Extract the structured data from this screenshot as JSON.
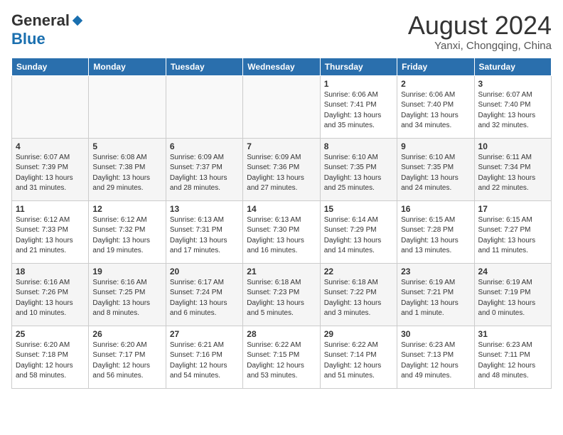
{
  "logo": {
    "general": "General",
    "blue": "Blue"
  },
  "header": {
    "month": "August 2024",
    "location": "Yanxi, Chongqing, China"
  },
  "days_of_week": [
    "Sunday",
    "Monday",
    "Tuesday",
    "Wednesday",
    "Thursday",
    "Friday",
    "Saturday"
  ],
  "weeks": [
    [
      {
        "day": "",
        "info": ""
      },
      {
        "day": "",
        "info": ""
      },
      {
        "day": "",
        "info": ""
      },
      {
        "day": "",
        "info": ""
      },
      {
        "day": "1",
        "info": "Sunrise: 6:06 AM\nSunset: 7:41 PM\nDaylight: 13 hours\nand 35 minutes."
      },
      {
        "day": "2",
        "info": "Sunrise: 6:06 AM\nSunset: 7:40 PM\nDaylight: 13 hours\nand 34 minutes."
      },
      {
        "day": "3",
        "info": "Sunrise: 6:07 AM\nSunset: 7:40 PM\nDaylight: 13 hours\nand 32 minutes."
      }
    ],
    [
      {
        "day": "4",
        "info": "Sunrise: 6:07 AM\nSunset: 7:39 PM\nDaylight: 13 hours\nand 31 minutes."
      },
      {
        "day": "5",
        "info": "Sunrise: 6:08 AM\nSunset: 7:38 PM\nDaylight: 13 hours\nand 29 minutes."
      },
      {
        "day": "6",
        "info": "Sunrise: 6:09 AM\nSunset: 7:37 PM\nDaylight: 13 hours\nand 28 minutes."
      },
      {
        "day": "7",
        "info": "Sunrise: 6:09 AM\nSunset: 7:36 PM\nDaylight: 13 hours\nand 27 minutes."
      },
      {
        "day": "8",
        "info": "Sunrise: 6:10 AM\nSunset: 7:35 PM\nDaylight: 13 hours\nand 25 minutes."
      },
      {
        "day": "9",
        "info": "Sunrise: 6:10 AM\nSunset: 7:35 PM\nDaylight: 13 hours\nand 24 minutes."
      },
      {
        "day": "10",
        "info": "Sunrise: 6:11 AM\nSunset: 7:34 PM\nDaylight: 13 hours\nand 22 minutes."
      }
    ],
    [
      {
        "day": "11",
        "info": "Sunrise: 6:12 AM\nSunset: 7:33 PM\nDaylight: 13 hours\nand 21 minutes."
      },
      {
        "day": "12",
        "info": "Sunrise: 6:12 AM\nSunset: 7:32 PM\nDaylight: 13 hours\nand 19 minutes."
      },
      {
        "day": "13",
        "info": "Sunrise: 6:13 AM\nSunset: 7:31 PM\nDaylight: 13 hours\nand 17 minutes."
      },
      {
        "day": "14",
        "info": "Sunrise: 6:13 AM\nSunset: 7:30 PM\nDaylight: 13 hours\nand 16 minutes."
      },
      {
        "day": "15",
        "info": "Sunrise: 6:14 AM\nSunset: 7:29 PM\nDaylight: 13 hours\nand 14 minutes."
      },
      {
        "day": "16",
        "info": "Sunrise: 6:15 AM\nSunset: 7:28 PM\nDaylight: 13 hours\nand 13 minutes."
      },
      {
        "day": "17",
        "info": "Sunrise: 6:15 AM\nSunset: 7:27 PM\nDaylight: 13 hours\nand 11 minutes."
      }
    ],
    [
      {
        "day": "18",
        "info": "Sunrise: 6:16 AM\nSunset: 7:26 PM\nDaylight: 13 hours\nand 10 minutes."
      },
      {
        "day": "19",
        "info": "Sunrise: 6:16 AM\nSunset: 7:25 PM\nDaylight: 13 hours\nand 8 minutes."
      },
      {
        "day": "20",
        "info": "Sunrise: 6:17 AM\nSunset: 7:24 PM\nDaylight: 13 hours\nand 6 minutes."
      },
      {
        "day": "21",
        "info": "Sunrise: 6:18 AM\nSunset: 7:23 PM\nDaylight: 13 hours\nand 5 minutes."
      },
      {
        "day": "22",
        "info": "Sunrise: 6:18 AM\nSunset: 7:22 PM\nDaylight: 13 hours\nand 3 minutes."
      },
      {
        "day": "23",
        "info": "Sunrise: 6:19 AM\nSunset: 7:21 PM\nDaylight: 13 hours\nand 1 minute."
      },
      {
        "day": "24",
        "info": "Sunrise: 6:19 AM\nSunset: 7:19 PM\nDaylight: 13 hours\nand 0 minutes."
      }
    ],
    [
      {
        "day": "25",
        "info": "Sunrise: 6:20 AM\nSunset: 7:18 PM\nDaylight: 12 hours\nand 58 minutes."
      },
      {
        "day": "26",
        "info": "Sunrise: 6:20 AM\nSunset: 7:17 PM\nDaylight: 12 hours\nand 56 minutes."
      },
      {
        "day": "27",
        "info": "Sunrise: 6:21 AM\nSunset: 7:16 PM\nDaylight: 12 hours\nand 54 minutes."
      },
      {
        "day": "28",
        "info": "Sunrise: 6:22 AM\nSunset: 7:15 PM\nDaylight: 12 hours\nand 53 minutes."
      },
      {
        "day": "29",
        "info": "Sunrise: 6:22 AM\nSunset: 7:14 PM\nDaylight: 12 hours\nand 51 minutes."
      },
      {
        "day": "30",
        "info": "Sunrise: 6:23 AM\nSunset: 7:13 PM\nDaylight: 12 hours\nand 49 minutes."
      },
      {
        "day": "31",
        "info": "Sunrise: 6:23 AM\nSunset: 7:11 PM\nDaylight: 12 hours\nand 48 minutes."
      }
    ]
  ]
}
